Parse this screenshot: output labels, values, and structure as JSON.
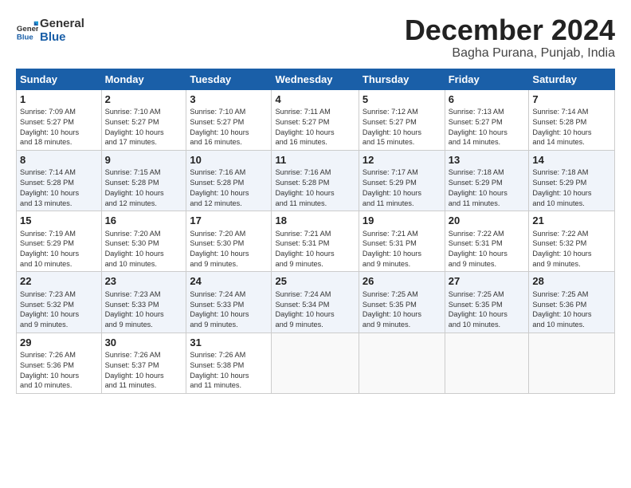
{
  "header": {
    "logo_line1": "General",
    "logo_line2": "Blue",
    "month_title": "December 2024",
    "location": "Bagha Purana, Punjab, India"
  },
  "days_of_week": [
    "Sunday",
    "Monday",
    "Tuesday",
    "Wednesday",
    "Thursday",
    "Friday",
    "Saturday"
  ],
  "weeks": [
    [
      {
        "day": "1",
        "info": "Sunrise: 7:09 AM\nSunset: 5:27 PM\nDaylight: 10 hours\nand 18 minutes."
      },
      {
        "day": "2",
        "info": "Sunrise: 7:10 AM\nSunset: 5:27 PM\nDaylight: 10 hours\nand 17 minutes."
      },
      {
        "day": "3",
        "info": "Sunrise: 7:10 AM\nSunset: 5:27 PM\nDaylight: 10 hours\nand 16 minutes."
      },
      {
        "day": "4",
        "info": "Sunrise: 7:11 AM\nSunset: 5:27 PM\nDaylight: 10 hours\nand 16 minutes."
      },
      {
        "day": "5",
        "info": "Sunrise: 7:12 AM\nSunset: 5:27 PM\nDaylight: 10 hours\nand 15 minutes."
      },
      {
        "day": "6",
        "info": "Sunrise: 7:13 AM\nSunset: 5:27 PM\nDaylight: 10 hours\nand 14 minutes."
      },
      {
        "day": "7",
        "info": "Sunrise: 7:14 AM\nSunset: 5:28 PM\nDaylight: 10 hours\nand 14 minutes."
      }
    ],
    [
      {
        "day": "8",
        "info": "Sunrise: 7:14 AM\nSunset: 5:28 PM\nDaylight: 10 hours\nand 13 minutes."
      },
      {
        "day": "9",
        "info": "Sunrise: 7:15 AM\nSunset: 5:28 PM\nDaylight: 10 hours\nand 12 minutes."
      },
      {
        "day": "10",
        "info": "Sunrise: 7:16 AM\nSunset: 5:28 PM\nDaylight: 10 hours\nand 12 minutes."
      },
      {
        "day": "11",
        "info": "Sunrise: 7:16 AM\nSunset: 5:28 PM\nDaylight: 10 hours\nand 11 minutes."
      },
      {
        "day": "12",
        "info": "Sunrise: 7:17 AM\nSunset: 5:29 PM\nDaylight: 10 hours\nand 11 minutes."
      },
      {
        "day": "13",
        "info": "Sunrise: 7:18 AM\nSunset: 5:29 PM\nDaylight: 10 hours\nand 11 minutes."
      },
      {
        "day": "14",
        "info": "Sunrise: 7:18 AM\nSunset: 5:29 PM\nDaylight: 10 hours\nand 10 minutes."
      }
    ],
    [
      {
        "day": "15",
        "info": "Sunrise: 7:19 AM\nSunset: 5:29 PM\nDaylight: 10 hours\nand 10 minutes."
      },
      {
        "day": "16",
        "info": "Sunrise: 7:20 AM\nSunset: 5:30 PM\nDaylight: 10 hours\nand 10 minutes."
      },
      {
        "day": "17",
        "info": "Sunrise: 7:20 AM\nSunset: 5:30 PM\nDaylight: 10 hours\nand 9 minutes."
      },
      {
        "day": "18",
        "info": "Sunrise: 7:21 AM\nSunset: 5:31 PM\nDaylight: 10 hours\nand 9 minutes."
      },
      {
        "day": "19",
        "info": "Sunrise: 7:21 AM\nSunset: 5:31 PM\nDaylight: 10 hours\nand 9 minutes."
      },
      {
        "day": "20",
        "info": "Sunrise: 7:22 AM\nSunset: 5:31 PM\nDaylight: 10 hours\nand 9 minutes."
      },
      {
        "day": "21",
        "info": "Sunrise: 7:22 AM\nSunset: 5:32 PM\nDaylight: 10 hours\nand 9 minutes."
      }
    ],
    [
      {
        "day": "22",
        "info": "Sunrise: 7:23 AM\nSunset: 5:32 PM\nDaylight: 10 hours\nand 9 minutes."
      },
      {
        "day": "23",
        "info": "Sunrise: 7:23 AM\nSunset: 5:33 PM\nDaylight: 10 hours\nand 9 minutes."
      },
      {
        "day": "24",
        "info": "Sunrise: 7:24 AM\nSunset: 5:33 PM\nDaylight: 10 hours\nand 9 minutes."
      },
      {
        "day": "25",
        "info": "Sunrise: 7:24 AM\nSunset: 5:34 PM\nDaylight: 10 hours\nand 9 minutes."
      },
      {
        "day": "26",
        "info": "Sunrise: 7:25 AM\nSunset: 5:35 PM\nDaylight: 10 hours\nand 9 minutes."
      },
      {
        "day": "27",
        "info": "Sunrise: 7:25 AM\nSunset: 5:35 PM\nDaylight: 10 hours\nand 10 minutes."
      },
      {
        "day": "28",
        "info": "Sunrise: 7:25 AM\nSunset: 5:36 PM\nDaylight: 10 hours\nand 10 minutes."
      }
    ],
    [
      {
        "day": "29",
        "info": "Sunrise: 7:26 AM\nSunset: 5:36 PM\nDaylight: 10 hours\nand 10 minutes."
      },
      {
        "day": "30",
        "info": "Sunrise: 7:26 AM\nSunset: 5:37 PM\nDaylight: 10 hours\nand 11 minutes."
      },
      {
        "day": "31",
        "info": "Sunrise: 7:26 AM\nSunset: 5:38 PM\nDaylight: 10 hours\nand 11 minutes."
      },
      null,
      null,
      null,
      null
    ]
  ]
}
